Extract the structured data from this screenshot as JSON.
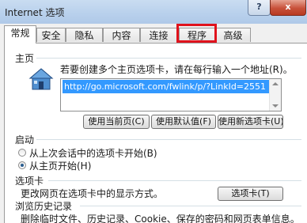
{
  "window": {
    "title": "Internet 选项",
    "help_label": "?",
    "close_label": "x"
  },
  "tabs": [
    {
      "label": "常规",
      "active": true
    },
    {
      "label": "安全"
    },
    {
      "label": "隐私"
    },
    {
      "label": "内容"
    },
    {
      "label": "连接"
    },
    {
      "label": "程序",
      "highlighted": true
    },
    {
      "label": "高级"
    }
  ],
  "homepage": {
    "section_title": "主页",
    "description": "若要创建多个主页选项卡，请在每行输入一个地址(R)。",
    "url": "http://go.microsoft.com/fwlink/p/?LinkId=2551",
    "btn_current": "使用当前页(C)",
    "btn_default": "使用默认值(F)",
    "btn_new_tab": "使用新选项卡(U)"
  },
  "startup": {
    "section_title": "启动",
    "option_tabs": "从上次会话中的选项卡开始(B)",
    "option_home": "从主页开始(H)",
    "selected": "option_home"
  },
  "tabs_section": {
    "section_title": "选项卡",
    "description": "更改网页在选项卡中的显示方式。",
    "button": "选项卡(T)"
  },
  "history": {
    "section_title": "浏览历史记录",
    "description": "删除临时文件、历史记录、Cookie、保存的密码和网页表单信息。"
  },
  "colors": {
    "highlight_border": "#e0121c",
    "selection": "#3399ff"
  }
}
